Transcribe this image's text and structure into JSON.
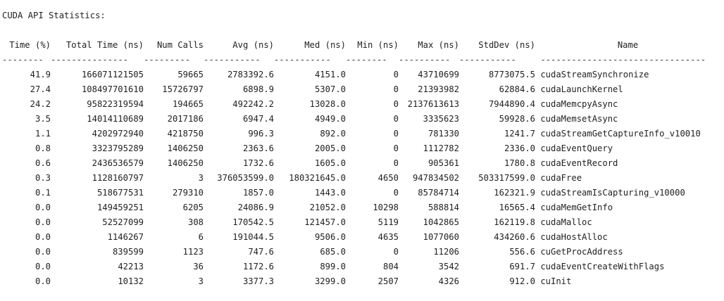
{
  "console": {
    "heading": "CUDA API Statistics:",
    "columns": [
      "Time (%)",
      "Total Time (ns)",
      "Num Calls",
      "Avg (ns)",
      "Med (ns)",
      "Min (ns)",
      "Max (ns)",
      "StdDev (ns)",
      "Name"
    ],
    "separators": [
      "--------",
      "---------------",
      "---------",
      "-----------",
      "-----------",
      "--------",
      "----------",
      "-----------",
      "--------------------------------"
    ],
    "rows": [
      [
        "41.9",
        "166071121505",
        "59665",
        "2783392.6",
        "4151.0",
        "0",
        "43710699",
        "8773075.5",
        "cudaStreamSynchronize"
      ],
      [
        "27.4",
        "108497701610",
        "15726797",
        "6898.9",
        "5307.0",
        "0",
        "21393982",
        "62884.6",
        "cudaLaunchKernel"
      ],
      [
        "24.2",
        "95822319594",
        "194665",
        "492242.2",
        "13028.0",
        "0",
        "2137613613",
        "7944890.4",
        "cudaMemcpyAsync"
      ],
      [
        "3.5",
        "14014110689",
        "2017186",
        "6947.4",
        "4949.0",
        "0",
        "3335623",
        "59928.6",
        "cudaMemsetAsync"
      ],
      [
        "1.1",
        "4202972940",
        "4218750",
        "996.3",
        "892.0",
        "0",
        "781330",
        "1241.7",
        "cudaStreamGetCaptureInfo_v10010"
      ],
      [
        "0.8",
        "3323795289",
        "1406250",
        "2363.6",
        "2005.0",
        "0",
        "1112782",
        "2336.0",
        "cudaEventQuery"
      ],
      [
        "0.6",
        "2436536579",
        "1406250",
        "1732.6",
        "1605.0",
        "0",
        "905361",
        "1780.8",
        "cudaEventRecord"
      ],
      [
        "0.3",
        "1128160797",
        "3",
        "376053599.0",
        "180321645.0",
        "4650",
        "947834502",
        "503317599.0",
        "cudaFree"
      ],
      [
        "0.1",
        "518677531",
        "279310",
        "1857.0",
        "1443.0",
        "0",
        "85784714",
        "162321.9",
        "cudaStreamIsCapturing_v10000"
      ],
      [
        "0.0",
        "149459251",
        "6205",
        "24086.9",
        "21052.0",
        "10298",
        "588814",
        "16565.4",
        "cudaMemGetInfo"
      ],
      [
        "0.0",
        "52527099",
        "308",
        "170542.5",
        "121457.0",
        "5119",
        "1042865",
        "162119.8",
        "cudaMalloc"
      ],
      [
        "0.0",
        "1146267",
        "6",
        "191044.5",
        "9506.0",
        "4635",
        "1077060",
        "434260.6",
        "cudaHostAlloc"
      ],
      [
        "0.0",
        "839599",
        "1123",
        "747.6",
        "685.0",
        "0",
        "11206",
        "556.6",
        "cuGetProcAddress"
      ],
      [
        "0.0",
        "42213",
        "36",
        "1172.6",
        "899.0",
        "804",
        "3542",
        "691.7",
        "cudaEventCreateWithFlags"
      ],
      [
        "0.0",
        "10132",
        "3",
        "3377.3",
        "3299.0",
        "2507",
        "4326",
        "912.0",
        "cuInit"
      ]
    ]
  }
}
